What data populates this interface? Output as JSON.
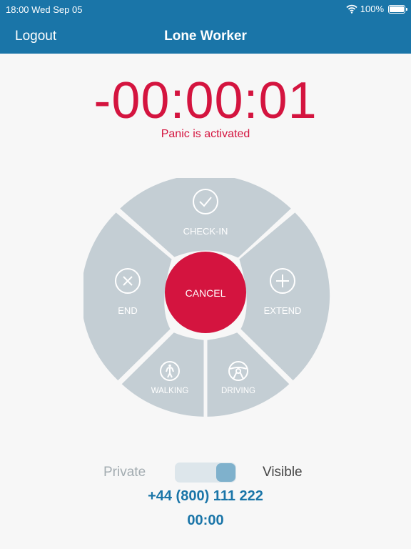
{
  "status_bar": {
    "time": "18:00 Wed Sep 05",
    "battery": "100%",
    "icons": [
      "wifi-icon",
      "battery-icon"
    ]
  },
  "nav": {
    "logout_label": "Logout",
    "title": "Lone Worker"
  },
  "timer": {
    "value": "-00:00:01",
    "status": "Panic is activated"
  },
  "wheel": {
    "checkin_label": "CHECK-IN",
    "end_label": "END",
    "extend_label": "EXTEND",
    "walking_label": "WALKING",
    "driving_label": "DRIVING",
    "cancel_label": "CANCEL",
    "icons": [
      "check-icon",
      "close-icon",
      "plus-icon",
      "walking-icon",
      "steering-wheel-icon"
    ]
  },
  "privacy": {
    "private_label": "Private",
    "visible_label": "Visible",
    "state": "Visible"
  },
  "phone": "+44 (800) 111 222",
  "elapsed": "00:00",
  "colors": {
    "primary": "#1a75a8",
    "alert": "#d4143f",
    "segment": "#c4ced4",
    "background": "#f7f7f7"
  }
}
